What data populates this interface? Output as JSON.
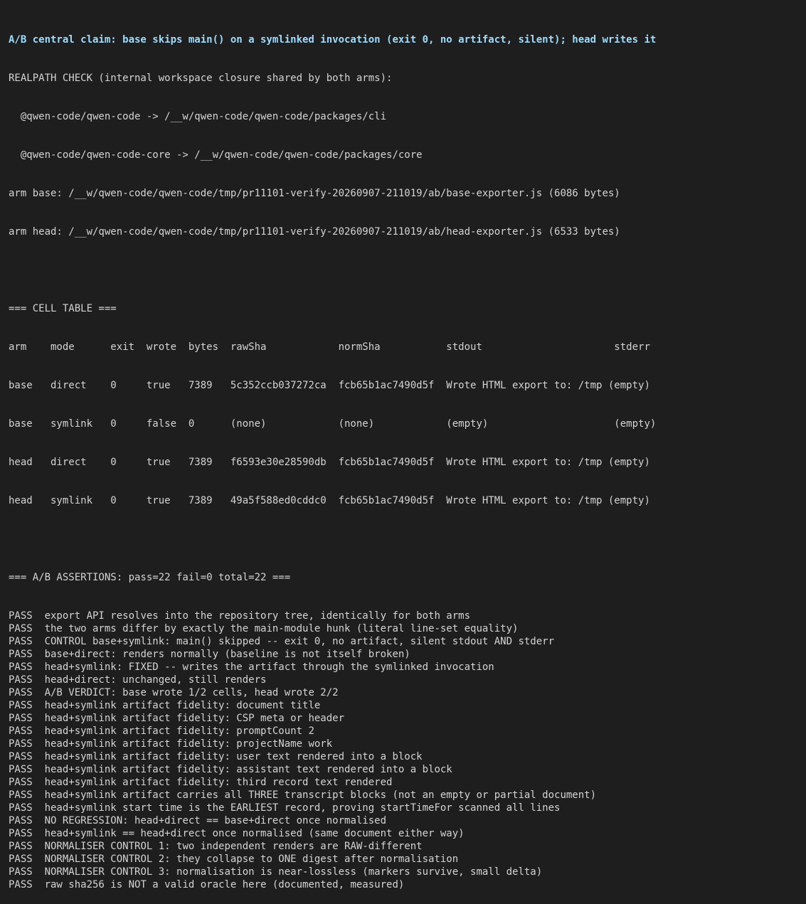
{
  "claim": "A/B central claim: base skips main() on a symlinked invocation (exit 0, no artifact, silent); head writes it",
  "realpath": {
    "heading": "REALPATH CHECK (internal workspace closure shared by both arms):",
    "lines": [
      "  @qwen-code/qwen-code -> /__w/qwen-code/qwen-code/packages/cli",
      "  @qwen-code/qwen-code-core -> /__w/qwen-code/qwen-code/packages/core"
    ]
  },
  "arms": [
    "arm base: /__w/qwen-code/qwen-code/tmp/pr11101-verify-20260907-211019/ab/base-exporter.js (6086 bytes)",
    "arm head: /__w/qwen-code/qwen-code/tmp/pr11101-verify-20260907-211019/ab/head-exporter.js (6533 bytes)"
  ],
  "cell_table": {
    "heading": "=== CELL TABLE ===",
    "header": "arm    mode      exit  wrote  bytes  rawSha            normSha           stdout                      stderr",
    "rows": [
      "base   direct    0     true   7389   5c352ccb037272ca  fcb65b1ac7490d5f  Wrote HTML export to: /tmp (empty)",
      "base   symlink   0     false  0      (none)            (none)            (empty)                     (empty)",
      "head   direct    0     true   7389   f6593e30e28590db  fcb65b1ac7490d5f  Wrote HTML export to: /tmp (empty)",
      "head   symlink   0     true   7389   49a5f588ed0cddc0  fcb65b1ac7490d5f  Wrote HTML export to: /tmp (empty)"
    ]
  },
  "assertions": {
    "heading": "=== A/B ASSERTIONS: pass=22 fail=0 total=22 ===",
    "items": [
      {
        "status": "PASS",
        "text": "export API resolves into the repository tree, identically for both arms"
      },
      {
        "status": "PASS",
        "text": "the two arms differ by exactly the main-module hunk (literal line-set equality)"
      },
      {
        "status": "PASS",
        "text": "CONTROL base+symlink: main() skipped -- exit 0, no artifact, silent stdout AND stderr"
      },
      {
        "status": "PASS",
        "text": "base+direct: renders normally (baseline is not itself broken)"
      },
      {
        "status": "PASS",
        "text": "head+symlink: FIXED -- writes the artifact through the symlinked invocation"
      },
      {
        "status": "PASS",
        "text": "head+direct: unchanged, still renders"
      },
      {
        "status": "PASS",
        "text": "A/B VERDICT: base wrote 1/2 cells, head wrote 2/2"
      },
      {
        "status": "PASS",
        "text": "head+symlink artifact fidelity: document title"
      },
      {
        "status": "PASS",
        "text": "head+symlink artifact fidelity: CSP meta or header"
      },
      {
        "status": "PASS",
        "text": "head+symlink artifact fidelity: promptCount 2"
      },
      {
        "status": "PASS",
        "text": "head+symlink artifact fidelity: projectName work"
      },
      {
        "status": "PASS",
        "text": "head+symlink artifact fidelity: user text rendered into a block"
      },
      {
        "status": "PASS",
        "text": "head+symlink artifact fidelity: assistant text rendered into a block"
      },
      {
        "status": "PASS",
        "text": "head+symlink artifact fidelity: third record text rendered"
      },
      {
        "status": "PASS",
        "text": "head+symlink artifact carries all THREE transcript blocks (not an empty or partial document)"
      },
      {
        "status": "PASS",
        "text": "head+symlink start time is the EARLIEST record, proving startTimeFor scanned all lines"
      },
      {
        "status": "PASS",
        "text": "NO REGRESSION: head+direct == base+direct once normalised"
      },
      {
        "status": "PASS",
        "text": "head+symlink == head+direct once normalised (same document either way)"
      },
      {
        "status": "PASS",
        "text": "NORMALISER CONTROL 1: two independent renders are RAW-different"
      },
      {
        "status": "PASS",
        "text": "NORMALISER CONTROL 2: they collapse to ONE digest after normalisation"
      },
      {
        "status": "PASS",
        "text": "NORMALISER CONTROL 3: normalisation is near-lossless (markers survive, small delta)"
      },
      {
        "status": "PASS",
        "text": "raw sha256 is NOT a valid oracle here (documented, measured)"
      }
    ]
  },
  "colors": {
    "background": "#1e1e1e",
    "foreground": "#d4d4d4",
    "claim": "#9cdcfe"
  }
}
